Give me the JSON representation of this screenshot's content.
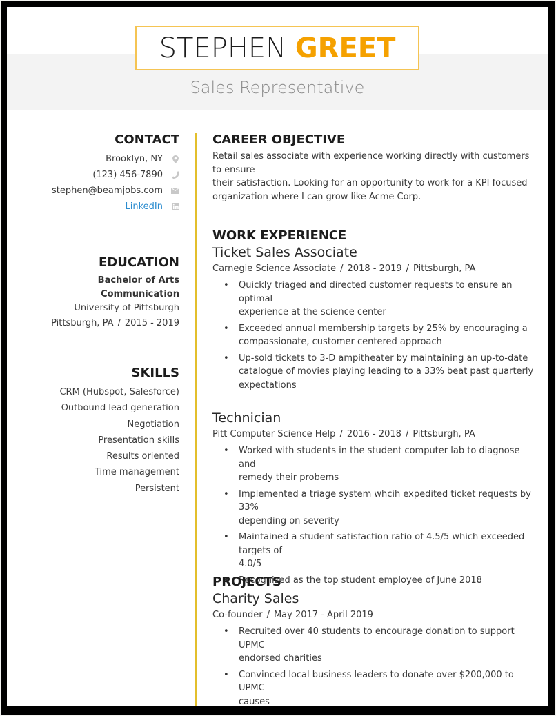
{
  "header": {
    "first_name": "STEPHEN",
    "last_name": "GREET",
    "title": "Sales Representative"
  },
  "colors": {
    "accent": "#f5a100",
    "divider": "#e3bf2c",
    "link": "#2b8ccf",
    "band": "#f3f3f3"
  },
  "contact": {
    "heading": "CONTACT",
    "items": [
      {
        "text": "Brooklyn, NY",
        "icon": "map-pin-icon"
      },
      {
        "text": "(123) 456-7890",
        "icon": "phone-icon"
      },
      {
        "text": "stephen@beamjobs.com",
        "icon": "envelope-icon"
      },
      {
        "text": "LinkedIn",
        "icon": "linkedin-icon"
      }
    ]
  },
  "education": {
    "heading": "EDUCATION",
    "degree": "Bachelor of Arts",
    "major": "Communication",
    "school": "University of Pittsburgh",
    "location": "Pittsburgh, PA",
    "separator": "/",
    "years": "2015 - 2019"
  },
  "skills": {
    "heading": "SKILLS",
    "items": [
      "CRM (Hubspot, Salesforce)",
      "Outbound lead generation",
      "Negotiation",
      "Presentation skills",
      "Results oriented",
      "Time management",
      "Persistent"
    ]
  },
  "objective": {
    "heading": "CAREER OBJECTIVE",
    "lines": [
      "Retail sales associate with experience working directly with customers to ensure",
      "their satisfaction. Looking for an opportunity to work for a KPI focused",
      "organization where I can grow like Acme Corp."
    ]
  },
  "experience": {
    "heading": "WORK EXPERIENCE",
    "jobs": [
      {
        "title": "Ticket Sales Associate",
        "company": "Carnegie Science Associate",
        "dates": "2018 - 2019",
        "location": "Pittsburgh, PA",
        "bullets": [
          [
            "Quickly triaged and directed customer requests to ensure an optimal",
            "experience at the science center"
          ],
          [
            "Exceeded annual membership targets by 25% by encouraging a",
            "compassionate, customer centered approach"
          ],
          [
            "Up-sold tickets to 3-D ampitheater by maintaining an up-to-date",
            "catalogue of movies playing leading to a 33% beat past quarterly",
            "expectations"
          ]
        ]
      },
      {
        "title": "Technician",
        "company": "Pitt Computer Science Help",
        "dates": "2016 - 2018",
        "location": "Pittsburgh, PA",
        "bullets": [
          [
            "Worked with students in the student computer lab to diagnose and",
            "remedy their probems"
          ],
          [
            "Implemented a triage system whcih expedited ticket requests by 33%",
            "depending on severity"
          ],
          [
            "Maintained a student satisfaction ratio of 4.5/5 which exceeded targets of",
            "4.0/5"
          ],
          [
            "Recognized as the top student employee of June 2018"
          ]
        ]
      }
    ]
  },
  "projects": {
    "heading": "PROJECTS",
    "items": [
      {
        "title": "Charity Sales",
        "role": "Co-founder",
        "dates": "May 2017 - April 2019",
        "bullets": [
          [
            "Recruited over 40 students to encourage donation to support UPMC",
            "endorsed charities"
          ],
          [
            "Convinced local business leaders to donate over $200,000 to UPMC",
            "causes"
          ]
        ]
      }
    ]
  },
  "separator": "/"
}
